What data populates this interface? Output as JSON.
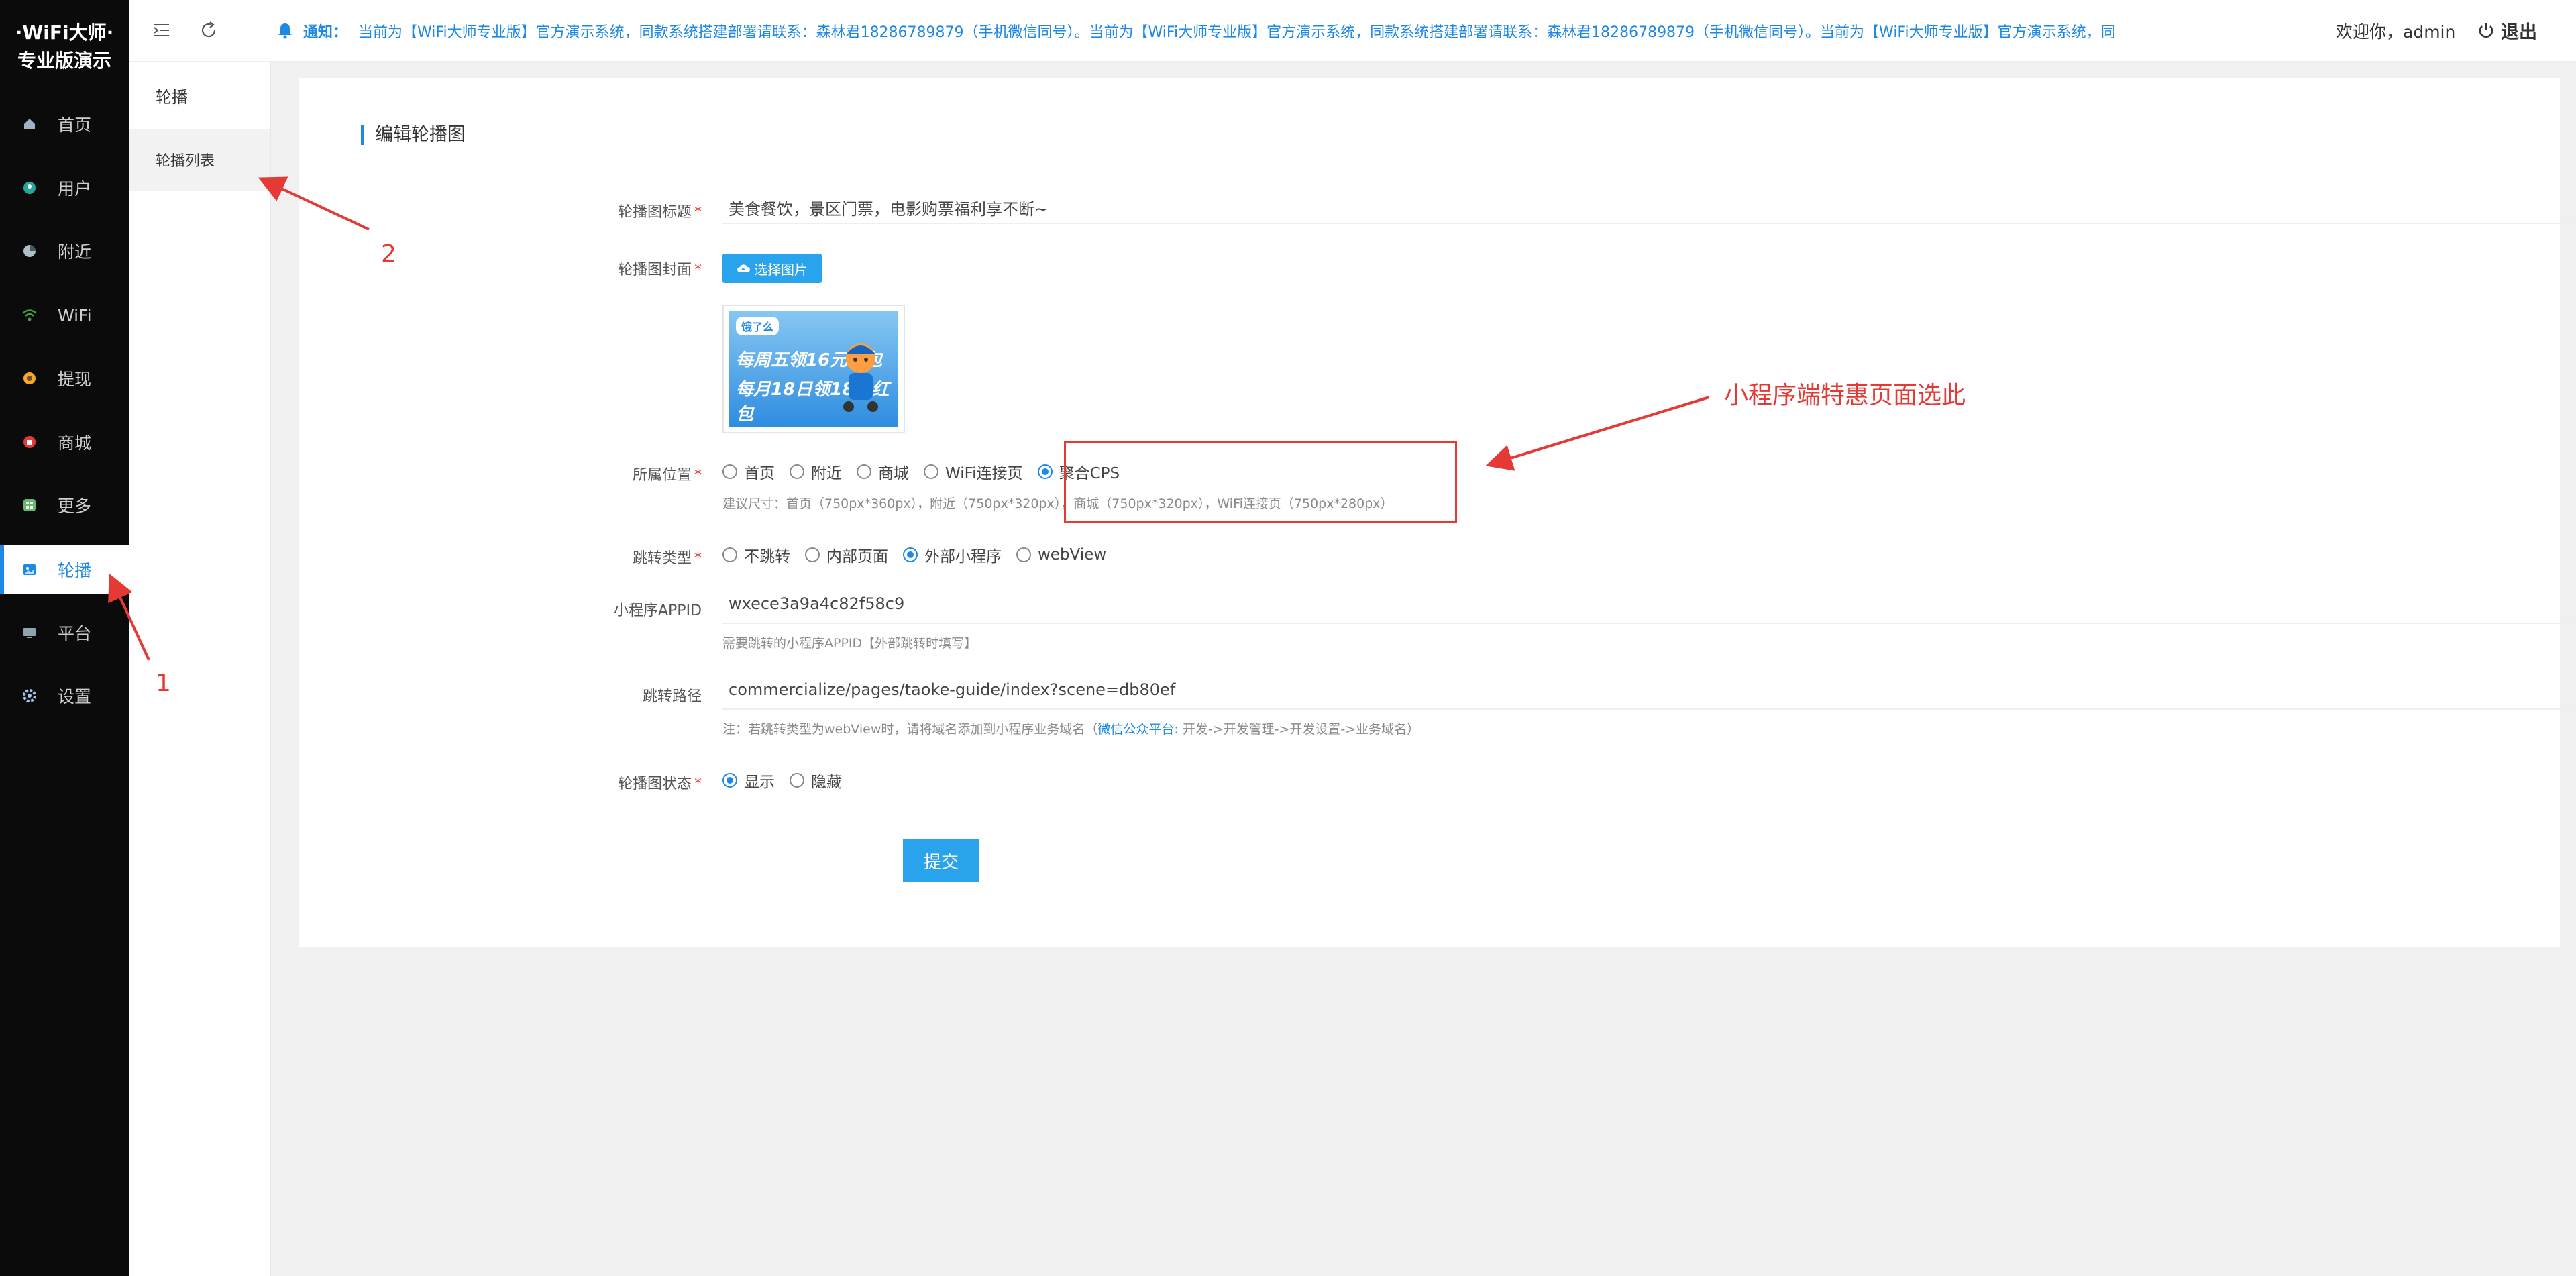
{
  "brand": {
    "line1": "·WiFi大师·",
    "line2": "专业版演示"
  },
  "sidebar": {
    "items": [
      {
        "label": "首页",
        "icon": "home-icon"
      },
      {
        "label": "用户",
        "icon": "user-icon"
      },
      {
        "label": "附近",
        "icon": "location-icon"
      },
      {
        "label": "WiFi",
        "icon": "wifi-icon"
      },
      {
        "label": "提现",
        "icon": "withdraw-icon"
      },
      {
        "label": "商城",
        "icon": "shop-icon"
      },
      {
        "label": "更多",
        "icon": "more-icon"
      },
      {
        "label": "轮播",
        "icon": "carousel-icon",
        "active": true
      },
      {
        "label": "平台",
        "icon": "platform-icon"
      },
      {
        "label": "设置",
        "icon": "gear-icon"
      }
    ]
  },
  "submenu": {
    "title": "轮播",
    "items": [
      "轮播列表"
    ]
  },
  "topbar": {
    "notice_label": "通知：",
    "notice_text": "当前为【WiFi大师专业版】官方演示系统，同款系统搭建部署请联系：森林君18286789879（手机微信同号）。当前为【WiFi大师专业版】官方演示系统，同款系统搭建部署请联系：森林君18286789879（手机微信同号）。当前为【WiFi大师专业版】官方演示系统，同",
    "welcome": "欢迎你，admin",
    "logout": "退出"
  },
  "form": {
    "card_title": "编辑轮播图",
    "title_label": "轮播图标题",
    "title_value": "美食餐饮，景区门票，电影购票福利享不断~",
    "cover_label": "轮播图封面",
    "upload_label": "选择图片",
    "banner": {
      "logo": "饿了么",
      "line1": "每周五领16元红包",
      "line2": "每月18日领18元红包"
    },
    "position_label": "所属位置",
    "position_options": [
      "首页",
      "附近",
      "商城",
      "WiFi连接页",
      "聚合CPS"
    ],
    "position_selected": "聚合CPS",
    "position_hint": "建议尺寸：首页（750px*360px），附近（750px*320px），商城（750px*320px），WiFi连接页（750px*280px）",
    "jump_label": "跳转类型",
    "jump_options": [
      "不跳转",
      "内部页面",
      "外部小程序",
      "webView"
    ],
    "jump_selected": "外部小程序",
    "appid_label": "小程序APPID",
    "appid_value": "wxece3a9a4c82f58c9",
    "appid_hint": "需要跳转的小程序APPID【外部跳转时填写】",
    "path_label": "跳转路径",
    "path_value": "commercialize/pages/taoke-guide/index?scene=db80ef",
    "path_hint_prefix": "注：若跳转类型为webView时，请将域名添加到小程序业务域名（",
    "path_hint_link": "微信公众平台:",
    "path_hint_suffix": " 开发->开发管理->开发设置->业务域名）",
    "status_label": "轮播图状态",
    "status_options": [
      "显示",
      "隐藏"
    ],
    "status_selected": "显示",
    "submit_label": "提交"
  },
  "annotations": {
    "note": "小程序端特惠页面选此",
    "num1": "1",
    "num2": "2",
    "color": "#e53935"
  },
  "colors": {
    "accent": "#1e88e5",
    "button": "#29a3ec",
    "sidebar_bg": "#0b0b0b"
  }
}
